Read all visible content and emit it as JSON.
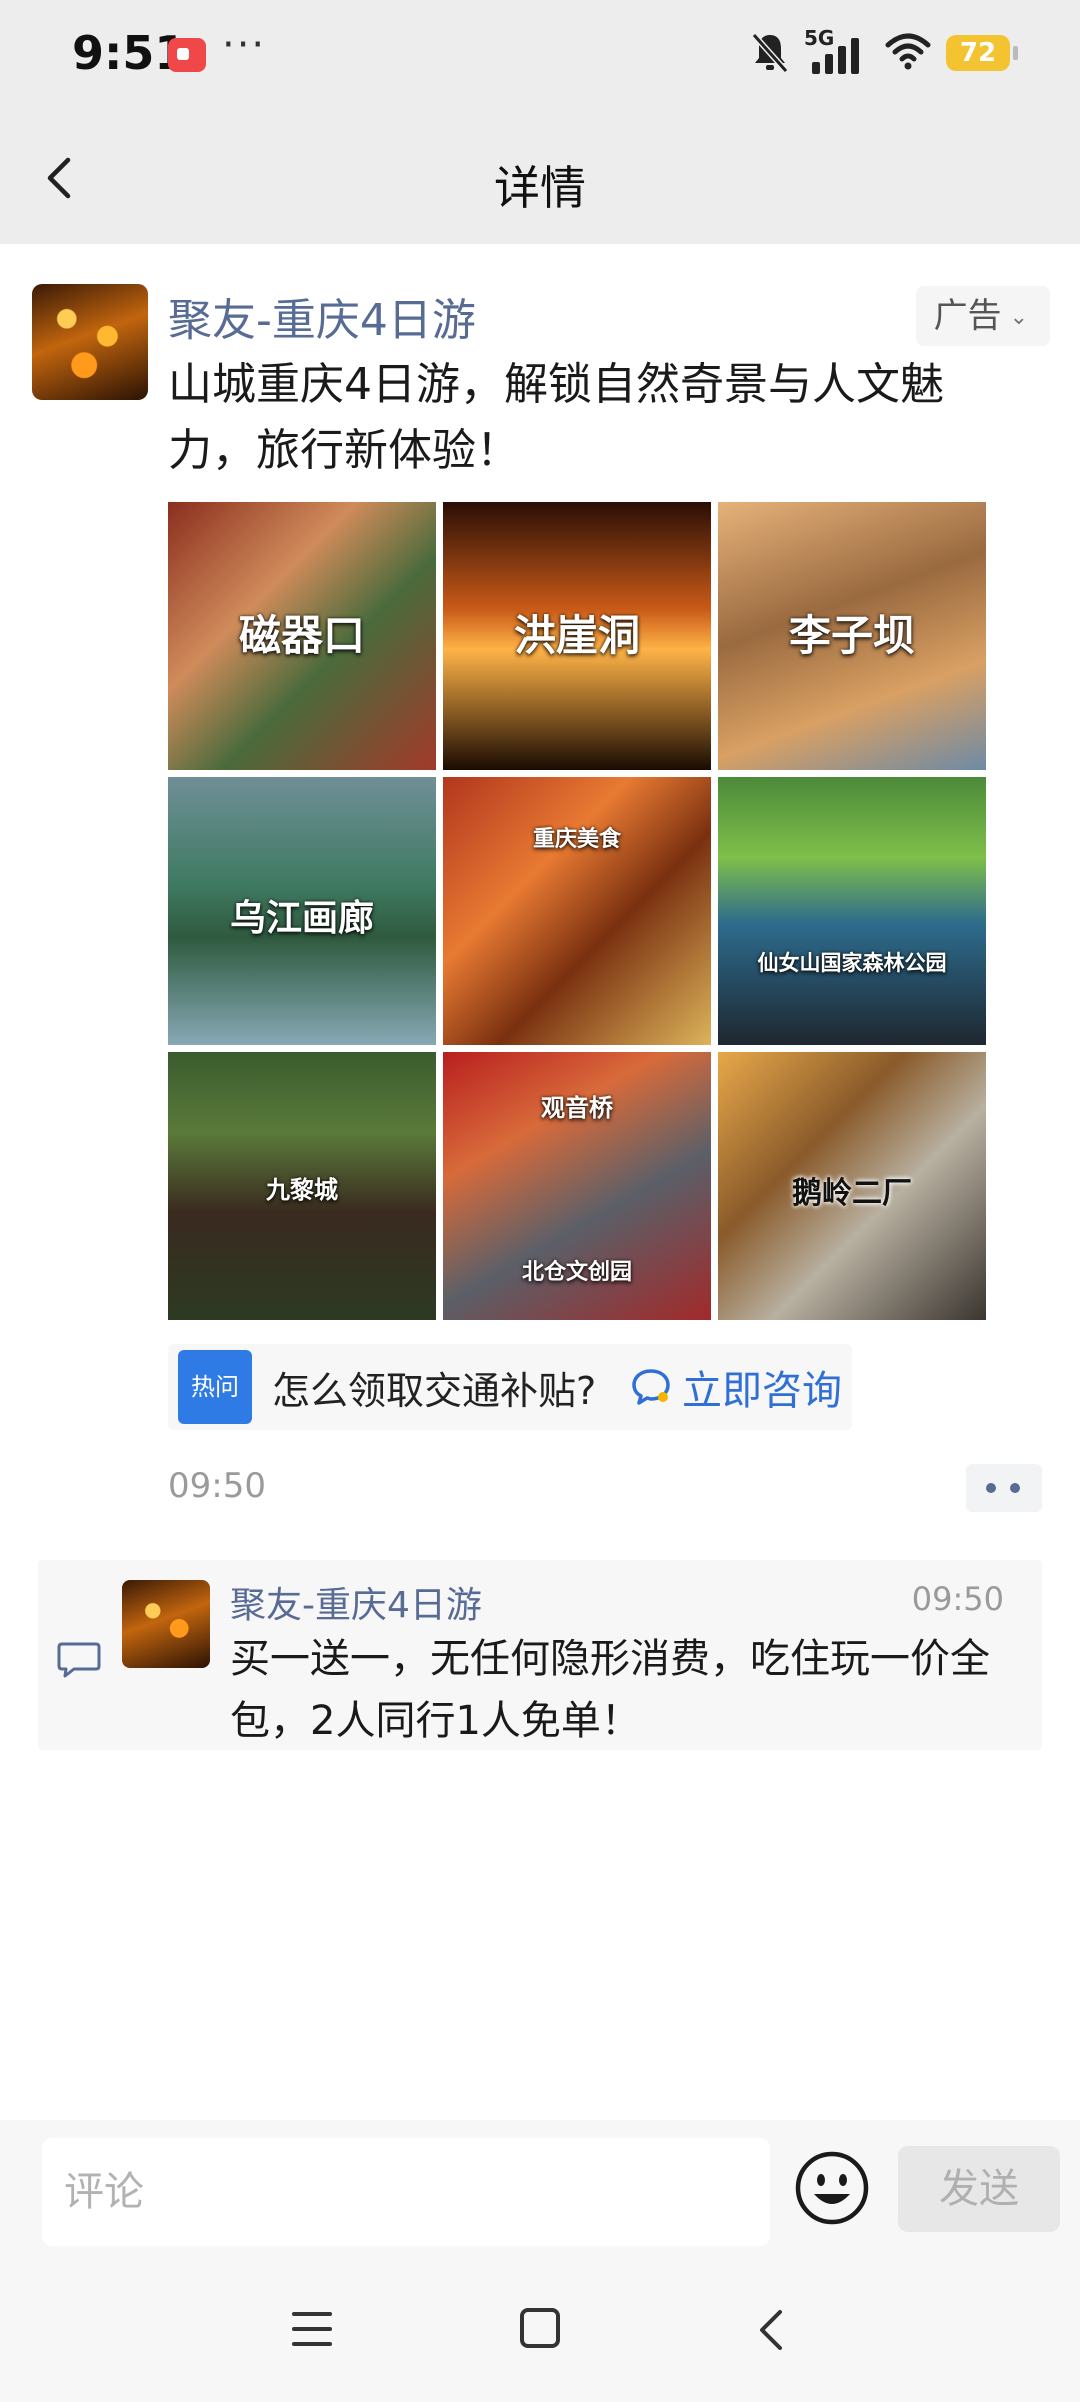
{
  "status_bar": {
    "time": "9:51",
    "dots": "···",
    "network": "5G",
    "battery": "72"
  },
  "nav": {
    "title": "详情"
  },
  "post": {
    "name": "聚友-重庆4日游",
    "ad_label": "广告",
    "text": "山城重庆4日游，解锁自然奇景与人文魅力，旅行新体验！",
    "tiles": [
      {
        "label": "磁器口"
      },
      {
        "label": "洪崖洞"
      },
      {
        "label": "李子坝"
      },
      {
        "label": "乌江画廊"
      },
      {
        "label": "重庆美食"
      },
      {
        "label": "仙女山国家森林公园"
      },
      {
        "label": "九黎城"
      },
      {
        "label": "观音桥",
        "label2": "北仓文创园"
      },
      {
        "label": "鹅岭二厂"
      }
    ],
    "hot_badge": "热问",
    "hot_question": "怎么领取交通补贴?",
    "consult_label": "立即咨询",
    "time": "09:50"
  },
  "comment": {
    "name": "聚友-重庆4日游",
    "time": "09:50",
    "text": "买一送一，无任何隐形消费，吃住玩一价全包，2人同行1人免单！"
  },
  "input": {
    "placeholder": "评论",
    "send_label": "发送"
  },
  "colors": {
    "link_blue": "#576b95",
    "consult_blue": "#2f6fd6",
    "hot_badge": "#2f7be6",
    "battery": "#f4c332"
  }
}
